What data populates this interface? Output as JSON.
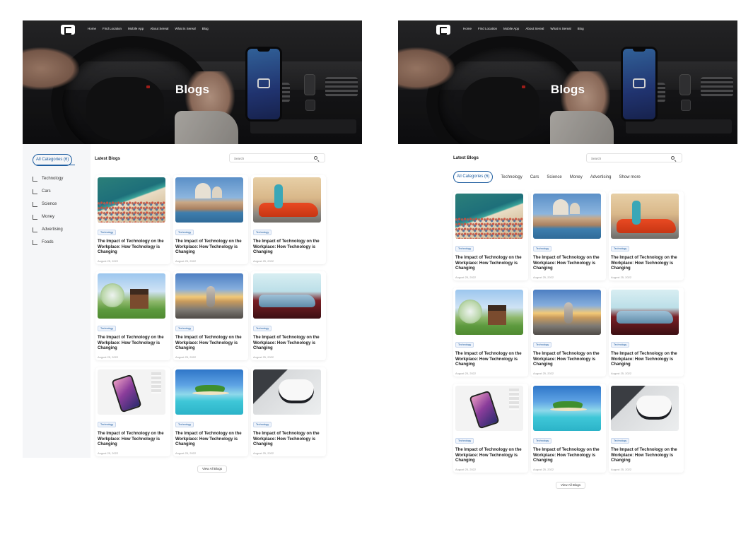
{
  "site": {
    "nav": [
      "Home",
      "Find Location",
      "Mobile App",
      "About Sereal",
      "What is Sereal",
      "Blog"
    ],
    "hero_title": "Blogs"
  },
  "sidebar": {
    "all_categories": "All Categories (6)",
    "items": [
      "Technology",
      "Cars",
      "Science",
      "Money",
      "Advertising",
      "Foods"
    ]
  },
  "content": {
    "latest_label": "Latest Blogs",
    "search_placeholder": "Search",
    "view_all": "View All Blogs"
  },
  "tabs": {
    "all_categories": "All Categories (6)",
    "items": [
      "Technology",
      "Cars",
      "Science",
      "Money",
      "Advertising"
    ],
    "show_more": "Show more"
  },
  "cards": [
    {
      "image": "beach",
      "tag": "Technology",
      "title": "The Impact of Technology on the Workplace: How Technology is Changing",
      "date": "August 25, 2022"
    },
    {
      "image": "venice",
      "tag": "Technology",
      "title": "The Impact of Technology on the Workplace: How Technology is Changing",
      "date": "August 25, 2022"
    },
    {
      "image": "red-car",
      "tag": "Technology",
      "title": "The Impact of Technology on the Workplace: How Technology is Changing",
      "date": "August 25, 2022"
    },
    {
      "image": "house",
      "tag": "Technology",
      "title": "The Impact of Technology on the Workplace: How Technology is Changing",
      "date": "August 25, 2022"
    },
    {
      "image": "stones",
      "tag": "Technology",
      "title": "The Impact of Technology on the Workplace: How Technology is Changing",
      "date": "August 25, 2022"
    },
    {
      "image": "blue-car",
      "tag": "Technology",
      "title": "The Impact of Technology on the Workplace: How Technology is Changing",
      "date": "August 25, 2022"
    },
    {
      "image": "phone",
      "tag": "Technology",
      "title": "The Impact of Technology on the Workplace: How Technology is Changing",
      "date": "August 25, 2022"
    },
    {
      "image": "island",
      "tag": "Technology",
      "title": "The Impact of Technology on the Workplace: How Technology is Changing",
      "date": "August 25, 2022"
    },
    {
      "image": "controller",
      "tag": "Technology",
      "title": "The Impact of Technology on the Workplace: How Technology is Changing",
      "date": "August 25, 2022"
    }
  ],
  "colors": {
    "accent": "#1f5ea0",
    "sidebar_bg": "#f5f6f8",
    "tag_bg": "#eef3fb"
  }
}
